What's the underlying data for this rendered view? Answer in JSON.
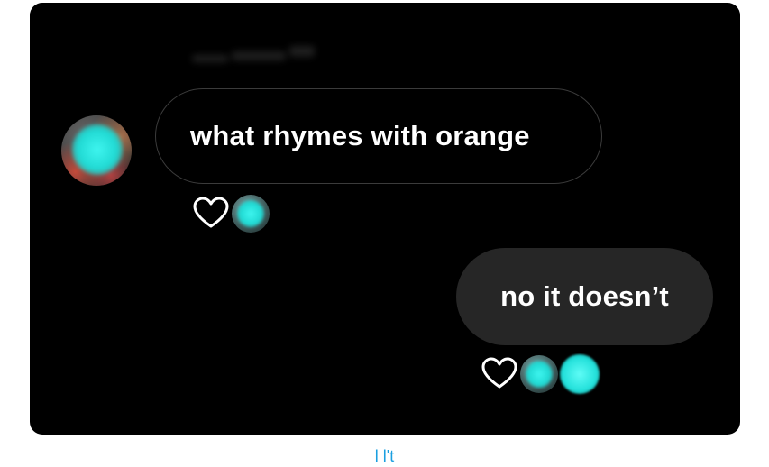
{
  "conversation": {
    "incoming": {
      "text": "what rhymes with orange"
    },
    "outgoing": {
      "text": "no it doesn’t"
    }
  },
  "reactions": {
    "incoming": [
      "heart-icon",
      "reactor-avatar"
    ],
    "outgoing": [
      "heart-icon",
      "reactor-avatar",
      "reactor-avatar"
    ]
  },
  "footer": {
    "link_text": "l l't"
  },
  "colors": {
    "background": "#000000",
    "incoming_border": "#3b3b3b",
    "outgoing_bubble": "#262626",
    "text": "#ffffff",
    "avatar_glow": "#20d9d3",
    "link": "#1a9fe0"
  }
}
